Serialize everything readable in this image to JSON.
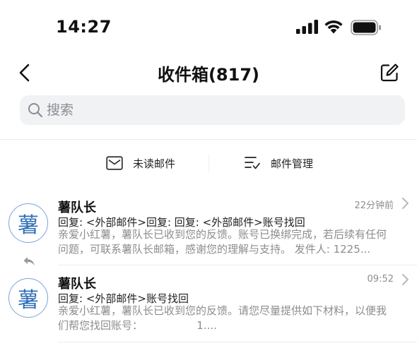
{
  "status_bar": {
    "time": "14:27"
  },
  "nav": {
    "title": "收件箱(817)"
  },
  "search": {
    "placeholder": "搜索"
  },
  "filters": {
    "unread_label": "未读邮件",
    "manage_label": "邮件管理"
  },
  "mails": [
    {
      "avatar": "薯",
      "sender": "薯队长",
      "subject": "回复: <外部邮件>回复: 回复: <外部邮件>账号找回",
      "preview": "亲爱小红薯，薯队长已收到您的反馈。账号已换绑完成，若后续有任何问题，可联系薯队长邮箱，感谢您的理解与支持。 发件人: 1225...",
      "time": "22分钟前",
      "replied": true
    },
    {
      "avatar": "薯",
      "sender": "薯队长",
      "subject": "回复: <外部邮件>账号找回",
      "preview": "亲爱小红薯，薯队长已收到您的反馈。请您尽量提供如下材料，以便我们帮您找回账号：                1....",
      "time": "09:52",
      "replied": false
    }
  ]
}
